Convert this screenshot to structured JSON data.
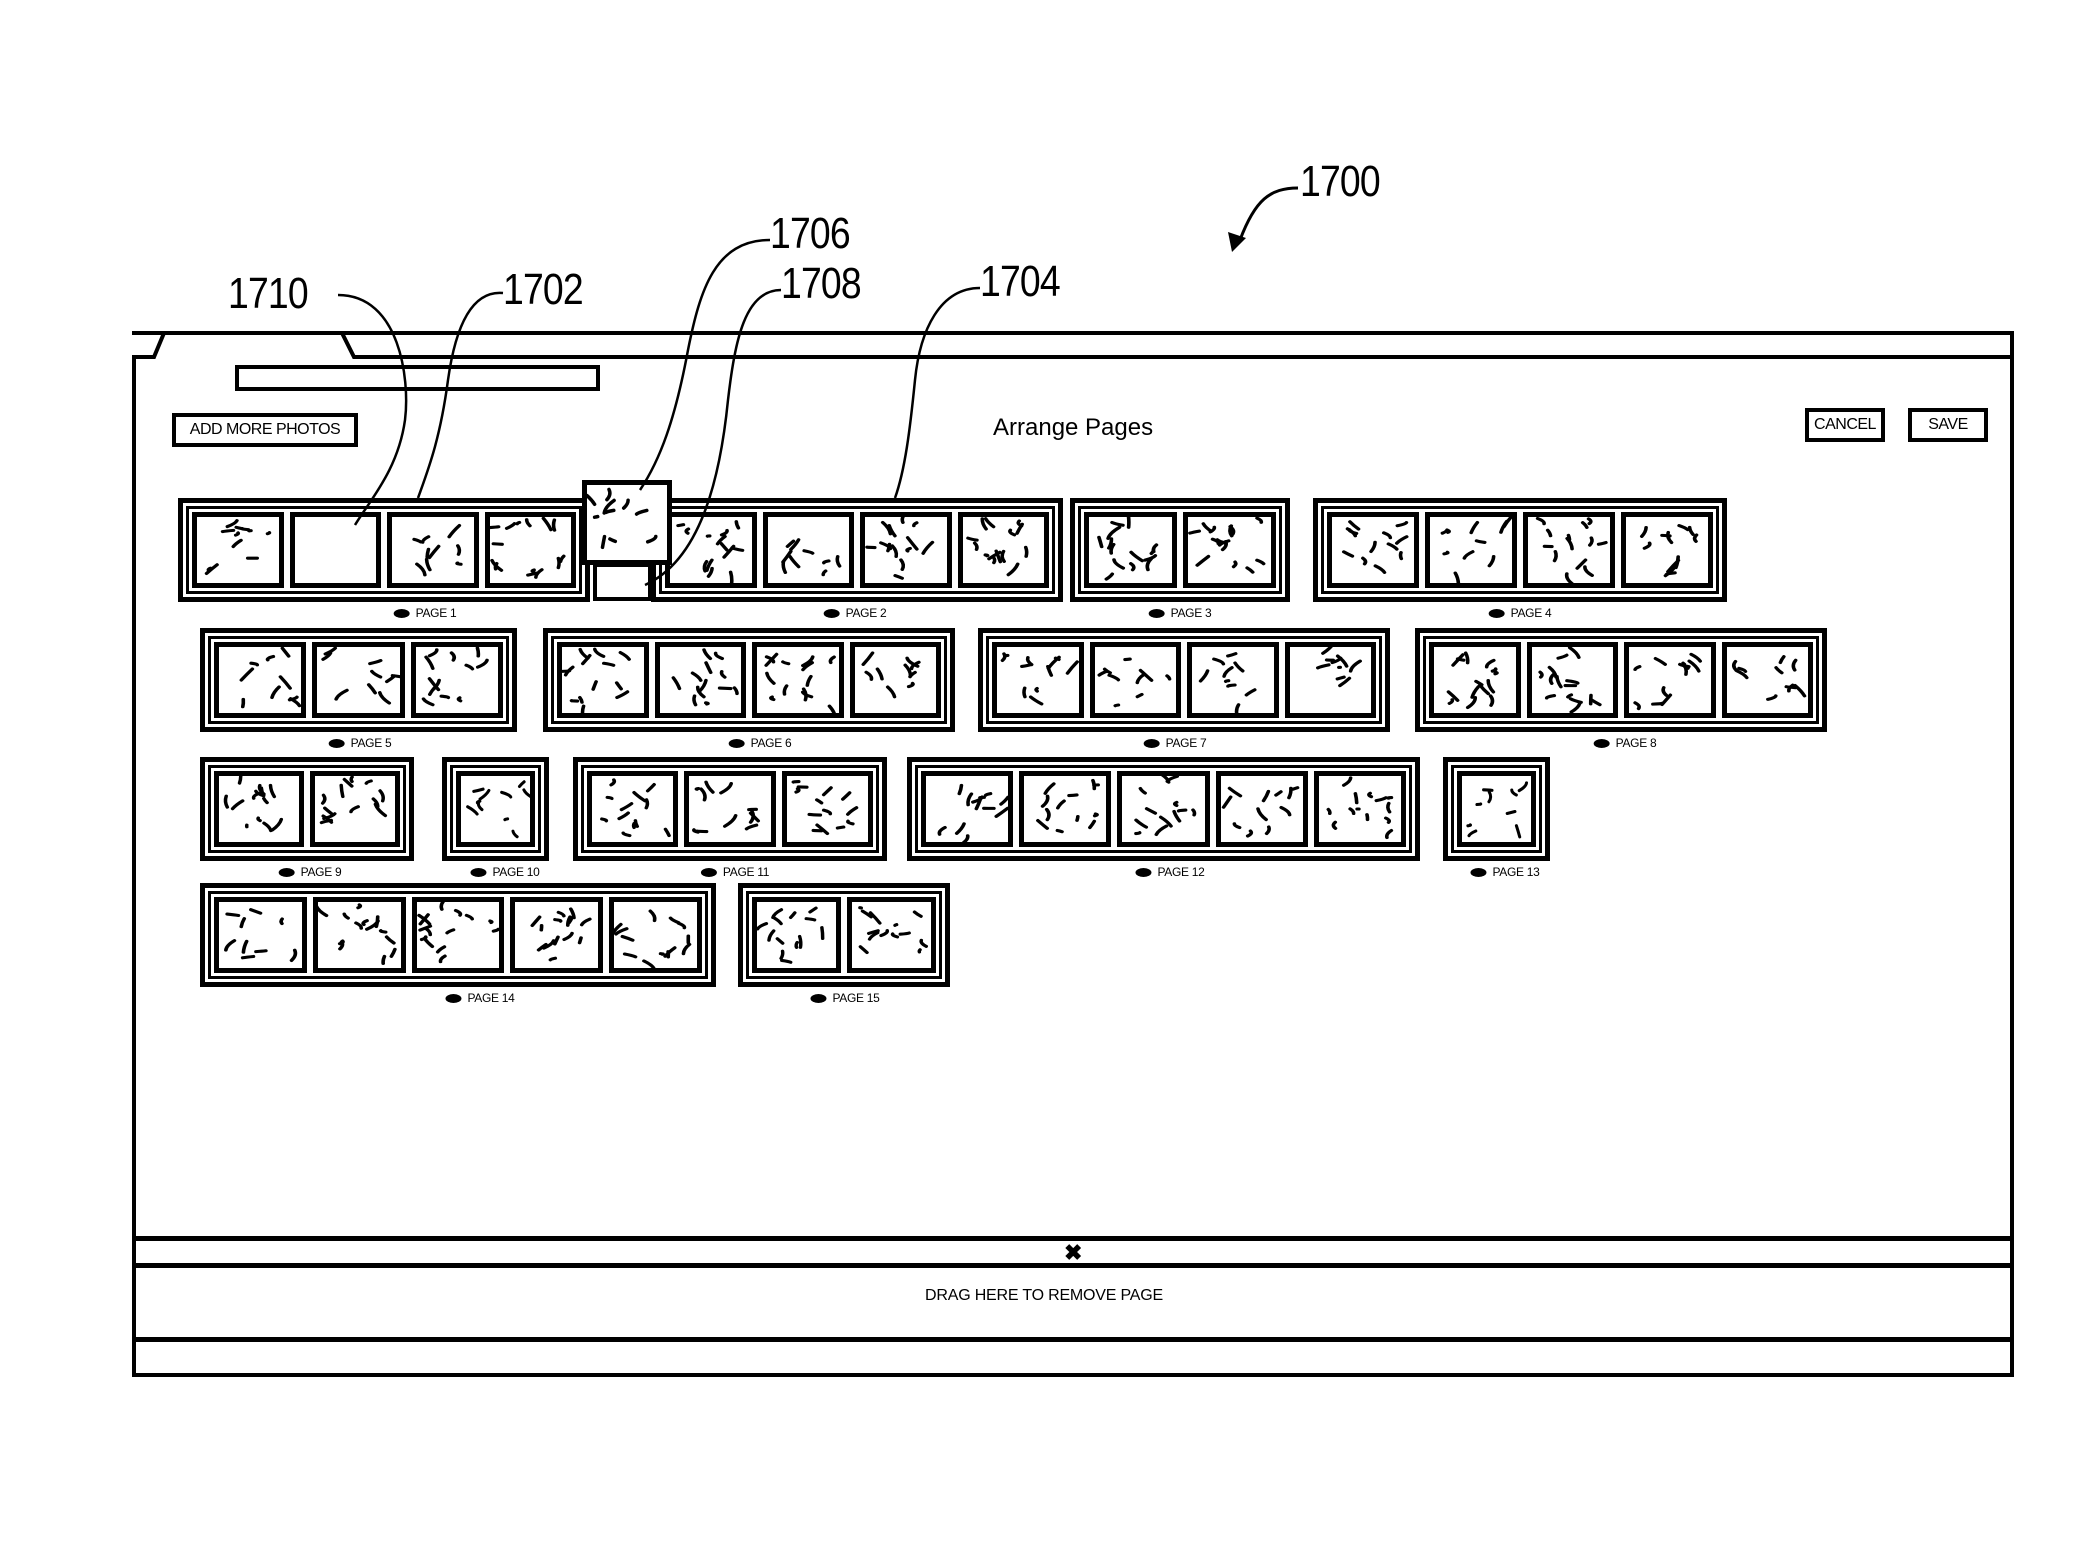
{
  "figure": {
    "reference_numerals": {
      "figure": "1700",
      "page_frame": "1702",
      "page_frame_2": "1704",
      "dragged_photo": "1706",
      "drop_placeholder": "1708",
      "empty_slot": "1710"
    }
  },
  "toolbar": {
    "search_value": "",
    "add_more_photos_label": "ADD MORE PHOTOS",
    "title": "Arrange Pages",
    "cancel_label": "CANCEL",
    "save_label": "SAVE"
  },
  "pages": [
    {
      "label": "PAGE 1",
      "photo_count": 4,
      "empty_slots": [
        1
      ]
    },
    {
      "label": "PAGE 2",
      "photo_count": 4
    },
    {
      "label": "PAGE 3",
      "photo_count": 2
    },
    {
      "label": "PAGE 4",
      "photo_count": 4
    },
    {
      "label": "PAGE 5",
      "photo_count": 3
    },
    {
      "label": "PAGE 6",
      "photo_count": 4
    },
    {
      "label": "PAGE 7",
      "photo_count": 4
    },
    {
      "label": "PAGE 8",
      "photo_count": 4
    },
    {
      "label": "PAGE 9",
      "photo_count": 2
    },
    {
      "label": "PAGE 10",
      "photo_count": 1
    },
    {
      "label": "PAGE 11",
      "photo_count": 3
    },
    {
      "label": "PAGE 12",
      "photo_count": 5
    },
    {
      "label": "PAGE 13",
      "photo_count": 1
    },
    {
      "label": "PAGE 14",
      "photo_count": 5
    },
    {
      "label": "PAGE 15",
      "photo_count": 2
    }
  ],
  "remove_zone": {
    "icon": "close-x-icon",
    "label": "DRAG HERE TO REMOVE PAGE"
  },
  "icons": {
    "page_label_icon": "eye-icon"
  }
}
